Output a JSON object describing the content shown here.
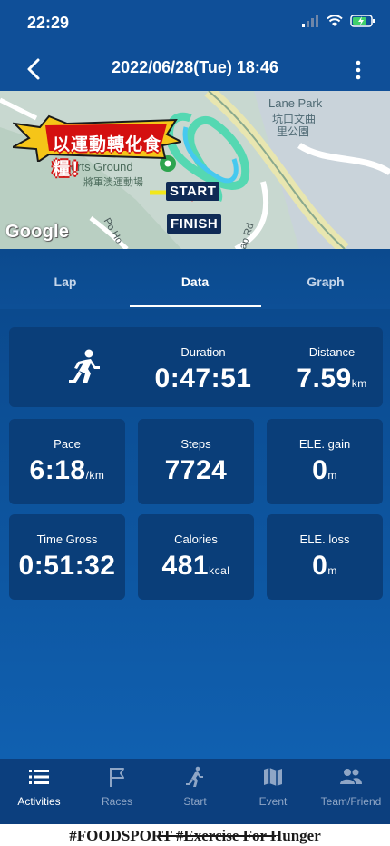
{
  "status_bar": {
    "time": "22:29"
  },
  "header": {
    "title": "2022/06/28(Tue) 18:46"
  },
  "map": {
    "place_label": "Lane Park",
    "place_label_zh_1": "坑口文曲",
    "place_label_zh_2": "里公園",
    "sports_label": "Sports Ground",
    "sports_label_zh": "將軍澳運動場",
    "road_1": "Po Ho",
    "road_2": "ap Rd",
    "start_badge": "START",
    "finish_badge": "FINISH",
    "promo_text": "以運動轉化食糧！",
    "google": "Google"
  },
  "tabs": {
    "lap": "Lap",
    "data": "Data",
    "graph": "Graph",
    "active": "Data"
  },
  "summary": {
    "duration_label": "Duration",
    "duration_value": "0:47:51",
    "distance_label": "Distance",
    "distance_value": "7.59",
    "distance_unit": "km"
  },
  "stats": {
    "pace_label": "Pace",
    "pace_value": "6:18",
    "pace_unit": "/km",
    "steps_label": "Steps",
    "steps_value": "7724",
    "ele_gain_label": "ELE. gain",
    "ele_gain_value": "0",
    "ele_gain_unit": "m",
    "time_gross_label": "Time Gross",
    "time_gross_value": "0:51:32",
    "calories_label": "Calories",
    "calories_value": "481",
    "calories_unit": "kcal",
    "ele_loss_label": "ELE. loss",
    "ele_loss_value": "0",
    "ele_loss_unit": "m"
  },
  "bottom_nav": {
    "items": [
      {
        "label": "Activities",
        "icon": "list-icon",
        "active": true
      },
      {
        "label": "Races",
        "icon": "flag-icon",
        "active": false
      },
      {
        "label": "Start",
        "icon": "runner-icon",
        "active": false
      },
      {
        "label": "Event",
        "icon": "map-icon",
        "active": false
      },
      {
        "label": "Team/Friend",
        "icon": "people-icon",
        "active": false
      }
    ]
  },
  "footer": {
    "text": "#FOODSPORT #Exercise For Hunger"
  },
  "colors": {
    "background": "#0c4b8f",
    "card": "#0a3e79",
    "header": "#0f4f98",
    "nav": "#0c3f7e"
  }
}
